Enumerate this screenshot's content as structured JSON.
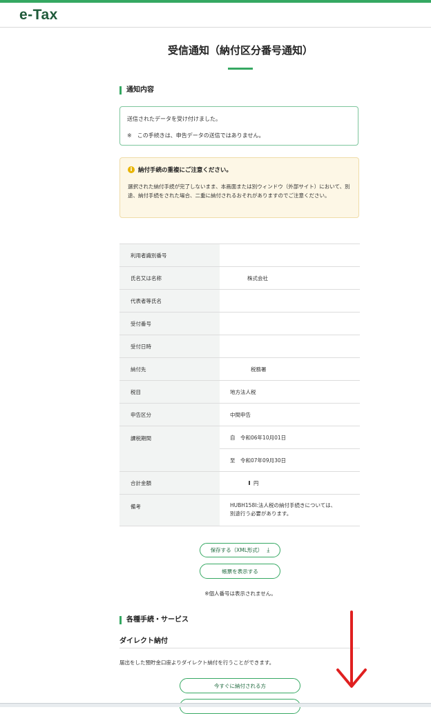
{
  "header": {
    "logo": "e-Tax"
  },
  "page": {
    "title": "受信通知（納付区分番号通知）"
  },
  "notice": {
    "heading": "通知内容",
    "line1": "送信されたデータを受け付けました。",
    "line2": "※　この手続きは、申告データの送信ではありません。"
  },
  "warning": {
    "icon": "info-icon",
    "title": "納付手続の重複にご注意ください。",
    "body": "選択された納付手続が完了しないまま、本画面または別ウィンドウ（外部サイト）において、別途、納付手続をされた場合、二重に納付されるおそれがありますのでご注意ください。"
  },
  "table": {
    "rows": [
      {
        "label": "利用者識別番号",
        "value": ""
      },
      {
        "label": "氏名又は名称",
        "value": "株式会社"
      },
      {
        "label": "代表者等氏名",
        "value": ""
      },
      {
        "label": "受付番号",
        "value": ""
      },
      {
        "label": "受付日時",
        "value": ""
      },
      {
        "label": "納付先",
        "value": "税務署"
      },
      {
        "label": "税目",
        "value": "地方法人税"
      },
      {
        "label": "申告区分",
        "value": "中間申告"
      }
    ],
    "period": {
      "label": "課税期間",
      "from": "自　令和06年10月01日",
      "to": "至　令和07年09月30日"
    },
    "total": {
      "label": "合計金額",
      "value": "円"
    },
    "remarks": {
      "label": "備考",
      "line1": "HUBH158I:法人税の納付手続きについては、",
      "line2": "別途行う必要があります。"
    }
  },
  "buttons": {
    "save": "保存する（XML形式）",
    "save_icon": "download-icon",
    "show_form": "帳票を表示する"
  },
  "note": "※個人番号は表示されません。",
  "services": {
    "heading": "各種手続・サービス",
    "direct_heading": "ダイレクト納付",
    "direct_text": "届出をした預貯金口座よりダイレクト納付を行うことができます。",
    "pay_now": "今すぐに納付される方"
  },
  "colors": {
    "accent": "#35a862",
    "arrow": "#e02020",
    "warning_bg": "#fdf7e6"
  }
}
